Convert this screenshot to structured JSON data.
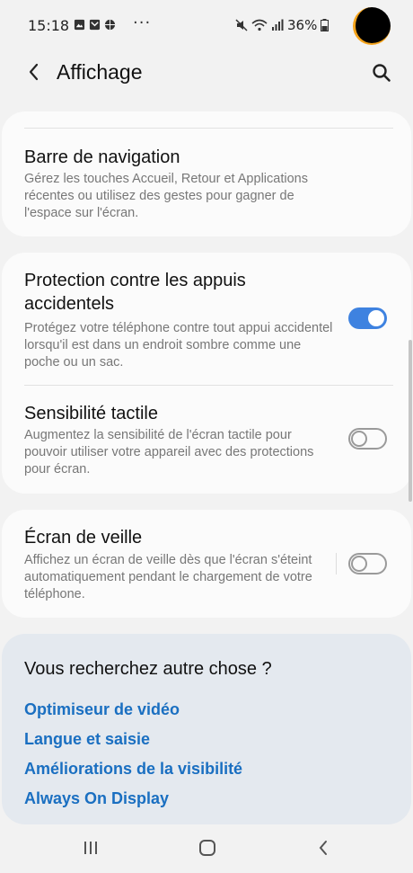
{
  "status_bar": {
    "time": "15:18",
    "more": "···",
    "battery_percent": "36%"
  },
  "header": {
    "title": "Affichage",
    "back_icon": "chevron-left-icon",
    "search_icon": "search-icon"
  },
  "cards": {
    "navigation": {
      "title": "Barre de navigation",
      "description": "Gérez les touches Accueil, Retour et Applications récentes ou utilisez des gestes pour gagner de l'espace sur l'écran."
    },
    "accidental": {
      "title": "Protection contre les appuis accidentels",
      "description": "Protégez votre téléphone contre tout appui accidentel lorsqu'il est dans un endroit sombre comme une poche ou un sac.",
      "enabled": true
    },
    "touch": {
      "title": "Sensibilité tactile",
      "description": "Augmentez la sensibilité de l'écran tactile pour pouvoir utiliser votre appareil avec des protections pour écran.",
      "enabled": false
    },
    "screensaver": {
      "title": "Écran de veille",
      "description": "Affichez un écran de veille dès que l'écran s'éteint automatiquement pendant le chargement de votre téléphone.",
      "enabled": false
    }
  },
  "suggestions": {
    "title": "Vous recherchez autre chose ?",
    "links": [
      "Optimiseur de vidéo",
      "Langue et saisie",
      "Améliorations de la visibilité",
      "Always On Display"
    ]
  },
  "colors": {
    "accent": "#3e82e0",
    "link": "#1a6fc1",
    "background": "#f2f2f2",
    "card": "#fbfbfb",
    "suggest_bg": "#e4e9ef"
  },
  "nav_bar": {
    "recents_icon": "recents-icon",
    "home_icon": "home-icon",
    "back_icon": "back-icon"
  }
}
